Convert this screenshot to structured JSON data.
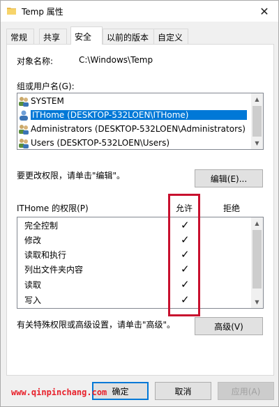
{
  "window": {
    "title": "Temp 属性",
    "close_glyph": "✕"
  },
  "tabs": [
    {
      "label": "常规"
    },
    {
      "label": "共享"
    },
    {
      "label": "安全",
      "active": true
    },
    {
      "label": "以前的版本"
    },
    {
      "label": "自定义"
    }
  ],
  "security": {
    "object_label": "对象名称:",
    "object_value": "C:\\Windows\\Temp",
    "group_label": "组或用户名(G):",
    "users": [
      {
        "name": "SYSTEM",
        "icon": "group-icon"
      },
      {
        "name": "ITHome (DESKTOP-532LOEN\\ITHome)",
        "icon": "user-icon",
        "selected": true
      },
      {
        "name": "Administrators (DESKTOP-532LOEN\\Administrators)",
        "icon": "group-icon"
      },
      {
        "name": "Users (DESKTOP-532LOEN\\Users)",
        "icon": "group-icon"
      }
    ],
    "edit_hint": "要更改权限，请单击\"编辑\"。",
    "edit_button": "编辑(E)...",
    "perm_label": "ITHome 的权限(P)",
    "allow_header": "允许",
    "deny_header": "拒绝",
    "permissions": [
      {
        "name": "完全控制",
        "allow": true,
        "deny": false
      },
      {
        "name": "修改",
        "allow": true,
        "deny": false
      },
      {
        "name": "读取和执行",
        "allow": true,
        "deny": false
      },
      {
        "name": "列出文件夹内容",
        "allow": true,
        "deny": false
      },
      {
        "name": "读取",
        "allow": true,
        "deny": false
      },
      {
        "name": "写入",
        "allow": true,
        "deny": false
      }
    ],
    "check_glyph": "✓",
    "advanced_hint": "有关特殊权限或高级设置，请单击\"高级\"。",
    "advanced_button": "高级(V)"
  },
  "footer": {
    "ok": "确定",
    "cancel": "取消",
    "apply": "应用(A)"
  },
  "watermark": "www.qinpinchang.com",
  "colors": {
    "selection": "#0078d7",
    "highlight_box": "#c8102e",
    "watermark": "#e8202a"
  }
}
